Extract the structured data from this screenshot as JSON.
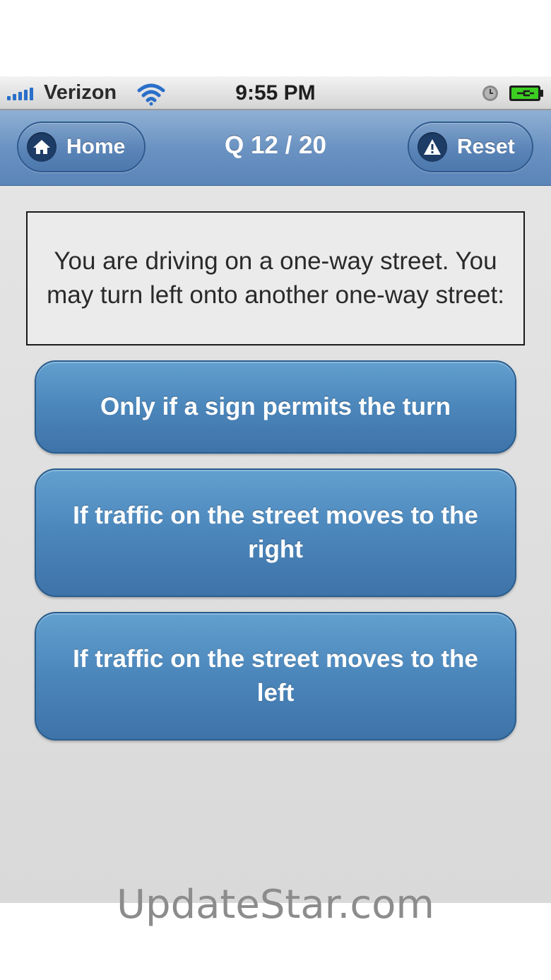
{
  "status_bar": {
    "carrier": "Verizon",
    "time": "9:55 PM",
    "signal_icon": "signal-bars-icon",
    "wifi_icon": "wifi-icon",
    "alarm_icon": "alarm-clock-icon",
    "battery_icon": "battery-charging-icon"
  },
  "nav": {
    "home_label": "Home",
    "home_icon": "home-icon",
    "title": "Q 12 / 20",
    "reset_label": "Reset",
    "reset_icon": "warning-icon"
  },
  "question": {
    "text": "You are driving on a one-way street. You may turn left onto another one-way street:"
  },
  "answers": [
    {
      "label": "Only if a sign permits the turn"
    },
    {
      "label": "If traffic on the street moves to the right"
    },
    {
      "label": "If traffic on the street moves to the left"
    }
  ],
  "watermark": "UpdateStar.com",
  "colors": {
    "nav_bar": "#6b93c2",
    "answer_button": "#4b86bb",
    "signal": "#2a6fc9",
    "battery": "#3ccf22"
  }
}
